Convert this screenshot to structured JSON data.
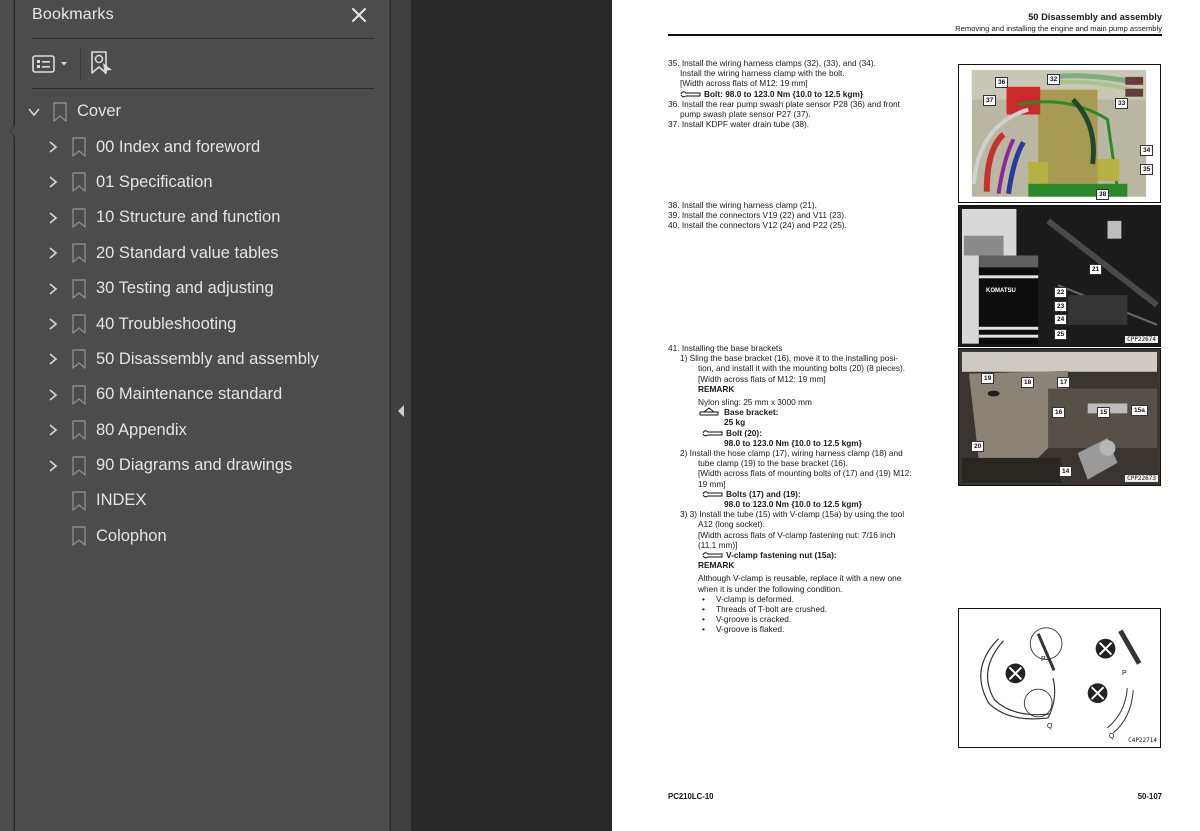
{
  "bookmarks_panel": {
    "title": "Bookmarks",
    "close_icon": "close-icon",
    "toolbar": {
      "options_icon": "list-options-icon",
      "options_dropdown_icon": "caret-down-icon",
      "find_bookmark_icon": "find-current-bookmark-icon"
    },
    "tree": [
      {
        "label": "Cover",
        "level": 0,
        "expanded": true,
        "has_children": true
      },
      {
        "label": "00 Index and foreword",
        "level": 1,
        "expanded": false,
        "has_children": true
      },
      {
        "label": "01 Specification",
        "level": 1,
        "expanded": false,
        "has_children": true
      },
      {
        "label": "10 Structure and function",
        "level": 1,
        "expanded": false,
        "has_children": true
      },
      {
        "label": "20 Standard value tables",
        "level": 1,
        "expanded": false,
        "has_children": true
      },
      {
        "label": "30 Testing and adjusting",
        "level": 1,
        "expanded": false,
        "has_children": true
      },
      {
        "label": "40 Troubleshooting",
        "level": 1,
        "expanded": false,
        "has_children": true
      },
      {
        "label": "50 Disassembly and assembly",
        "level": 1,
        "expanded": false,
        "has_children": true
      },
      {
        "label": "60 Maintenance standard",
        "level": 1,
        "expanded": false,
        "has_children": true
      },
      {
        "label": "80 Appendix",
        "level": 1,
        "expanded": false,
        "has_children": true
      },
      {
        "label": "90 Diagrams and drawings",
        "level": 1,
        "expanded": false,
        "has_children": true
      },
      {
        "label": "INDEX",
        "level": 1,
        "expanded": false,
        "has_children": false
      },
      {
        "label": "Colophon",
        "level": 1,
        "expanded": false,
        "has_children": false
      }
    ]
  },
  "splitter": {
    "collapse_icon": "collapse-panel-left-icon"
  },
  "document_page": {
    "header": {
      "section": "50 Disassembly and assembly",
      "subsection": "Removing and installing the engine and main pump assembly"
    },
    "steps_block1": [
      "35. Install the wiring harness clamps (32), (33), and (34).",
      "Install the wiring harness clamp with the bolt.",
      "[Width across flats of M12: 19 mm]",
      "Bolt: 98.0 to 123.0 Nm {10.0 to 12.5 kgm}",
      "36. Install the rear pump swash plate sensor P28 (36) and front",
      "pump swash plate sensor P27 (37).",
      "37. Install KDPF water drain tube (38)."
    ],
    "steps_block2": [
      "38. Install the wiring harness clamp (21).",
      "39. Install the connectors V19 (22) and V11 (23).",
      "40. Install the connectors V12 (24) and P22 (25)."
    ],
    "steps_block3": {
      "title": "41. Installing the base brackets",
      "sub1": [
        "1)  Sling the base bracket (16), move it to the installing posi-",
        "tion, and install it with the mounting bolts (20) (8 pieces).",
        "[Width across flats of M12: 19 mm]",
        "REMARK",
        "Nylon sling: 25 mm x 3000 mm",
        "Base bracket:",
        "25 kg",
        "Bolt (20):",
        "98.0 to 123.0 Nm {10.0 to 12.5 kgm}"
      ],
      "sub2": [
        "2)  Install the hose clamp (17), wiring harness clamp (18) and",
        "tube clamp (19) to the base bracket (16).",
        "[Width across flats of mounting bolts of (17) and (19) M12:",
        "19 mm]",
        "Bolts (17) and (19):",
        "98.0 to 123.0 Nm {10.0 to 12.5 kgm}"
      ],
      "sub3": [
        "3)  3) Install the tube (15) with V-clamp (15a) by using the tool",
        "A12 (long socket).",
        "[Width across flats of V-clamp fastening nut: 7/16 inch",
        "(11.1 mm)]",
        "V-clamp fastening nut (15a):",
        "REMARK",
        "Although V-clamp is reusable, replace it with a new one",
        "when it is under the following condition."
      ],
      "bullets": [
        "V-clamp is deformed.",
        "Threads of T-bolt are crushed.",
        "V-groove is cracked.",
        "V-groove is flaked."
      ]
    },
    "figures": {
      "fig1_callouts": [
        "36",
        "32",
        "37",
        "33",
        "34",
        "35",
        "38"
      ],
      "fig2_callouts": [
        "21",
        "22",
        "23",
        "24",
        "25"
      ],
      "fig2_code": "CPP22674",
      "fig2_filter_brand": "KOMATSU",
      "fig3_callouts": [
        "19",
        "18",
        "17",
        "16",
        "15",
        "15a",
        "20",
        "14"
      ],
      "fig3_code": "CPP22673",
      "fig4_labels": [
        "P",
        "Q",
        "P",
        "Q"
      ],
      "fig4_code": "C4P22714"
    },
    "footer": {
      "model": "PC210LC-10",
      "page_number": "50-107"
    }
  }
}
